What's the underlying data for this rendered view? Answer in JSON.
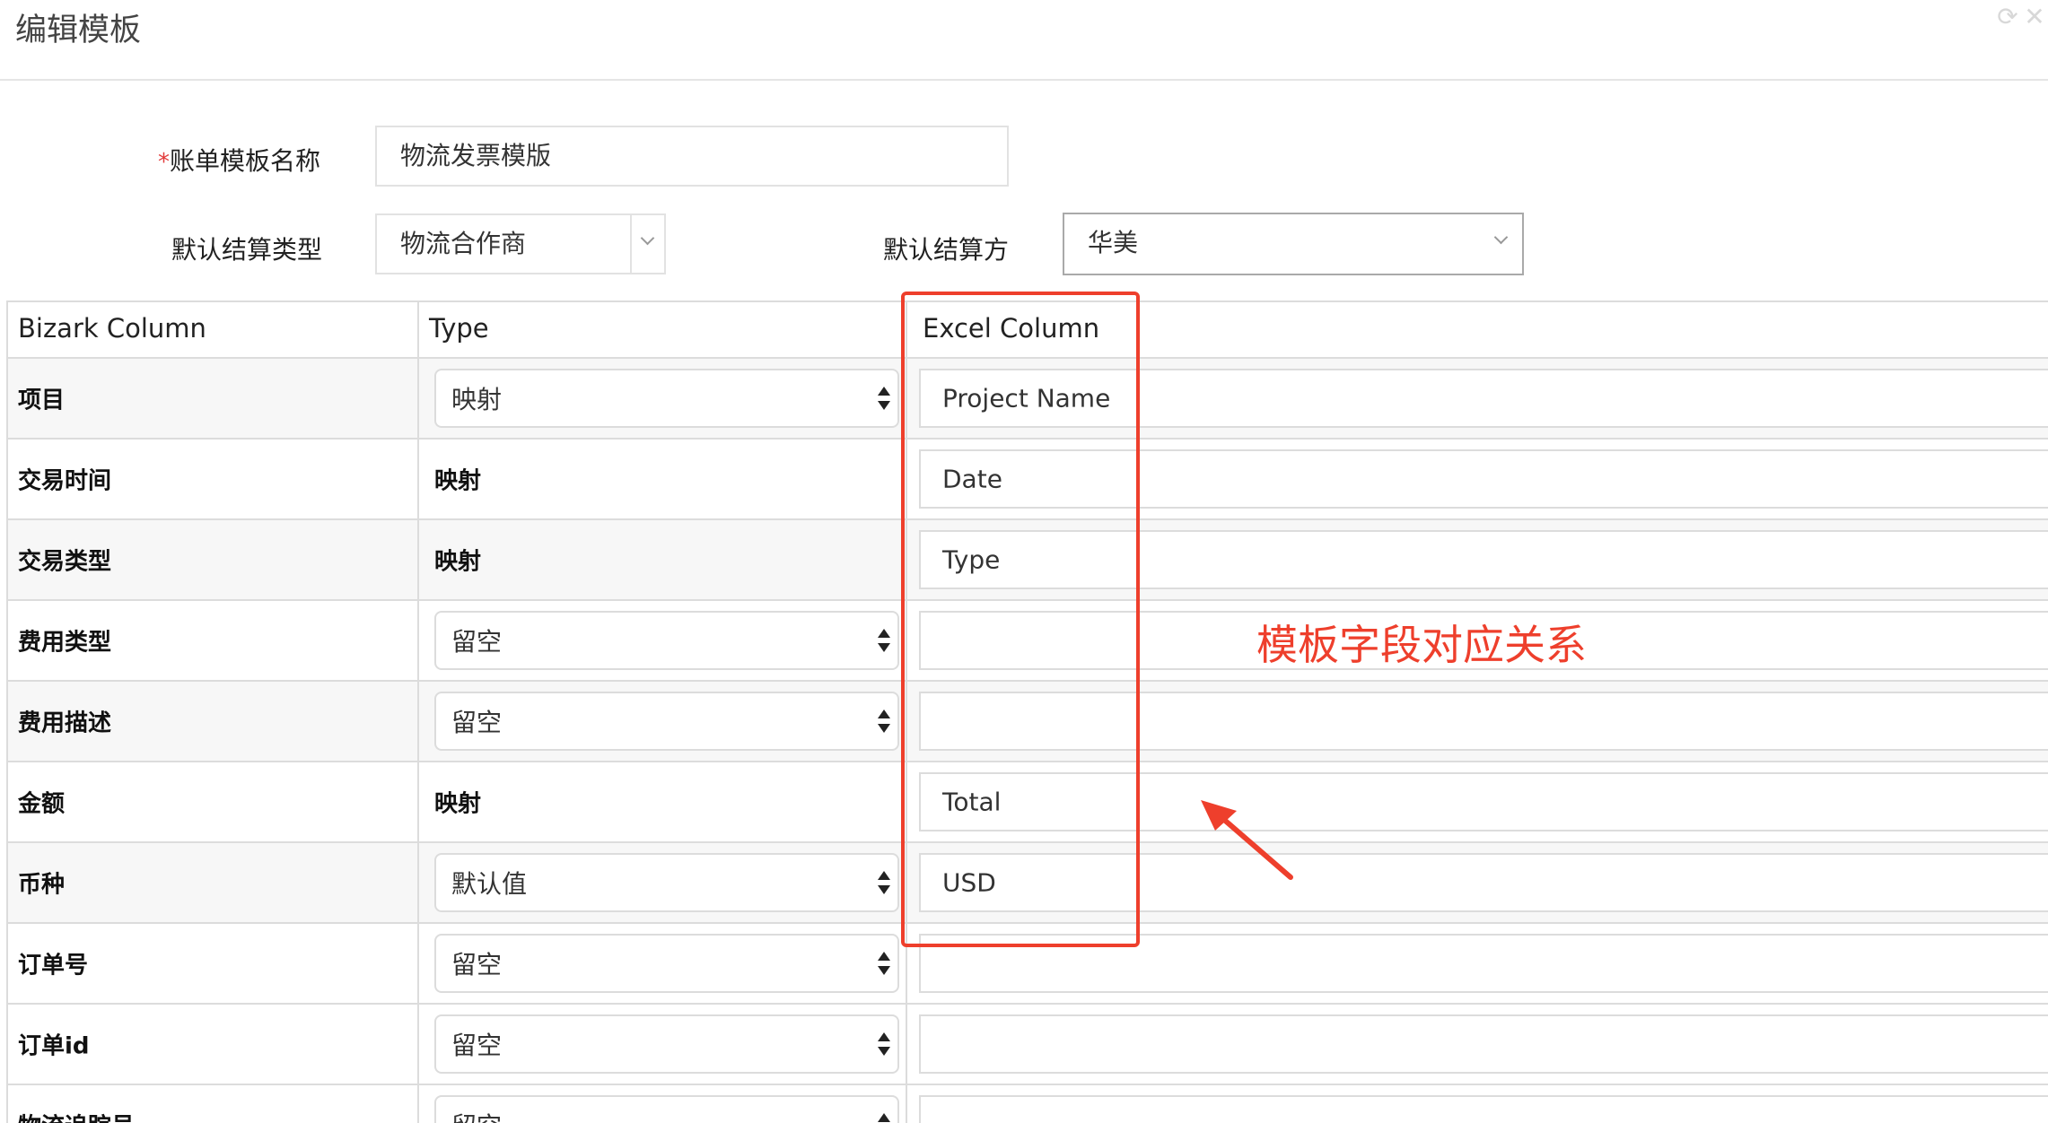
{
  "header": {
    "title": "编辑模板"
  },
  "form": {
    "template_name_label": "账单模板名称",
    "required_mark": "*",
    "template_name_value": "物流发票模版",
    "settle_type_label": "默认结算类型",
    "settle_type_value": "物流合作商",
    "settle_party_label": "默认结算方",
    "settle_party_value": "华美"
  },
  "table": {
    "headers": [
      "Bizark Column",
      "Type",
      "Excel Column"
    ],
    "rows": [
      {
        "label": "项目",
        "type": "映射",
        "type_control": "select",
        "excel": "Project Name"
      },
      {
        "label": "交易时间",
        "type": "映射",
        "type_control": "static",
        "excel": "Date"
      },
      {
        "label": "交易类型",
        "type": "映射",
        "type_control": "static",
        "excel": "Type"
      },
      {
        "label": "费用类型",
        "type": "留空",
        "type_control": "select",
        "excel": ""
      },
      {
        "label": "费用描述",
        "type": "留空",
        "type_control": "select",
        "excel": ""
      },
      {
        "label": "金额",
        "type": "映射",
        "type_control": "static",
        "excel": "Total"
      },
      {
        "label": "币种",
        "type": "默认值",
        "type_control": "select",
        "excel": "USD"
      },
      {
        "label": "订单号",
        "type": "留空",
        "type_control": "select",
        "excel": ""
      },
      {
        "label": "订单id",
        "type": "留空",
        "type_control": "select",
        "excel": ""
      },
      {
        "label": "物流追踪号",
        "type": "留空",
        "type_control": "select",
        "excel": ""
      }
    ]
  },
  "annotation": {
    "text": "模板字段对应关系",
    "color": "#ee3f2c"
  },
  "icons": {
    "header": [
      "refresh-icon",
      "close-icon"
    ],
    "select": "chevron-down-icon",
    "native_select": "updown-arrows-icon"
  }
}
